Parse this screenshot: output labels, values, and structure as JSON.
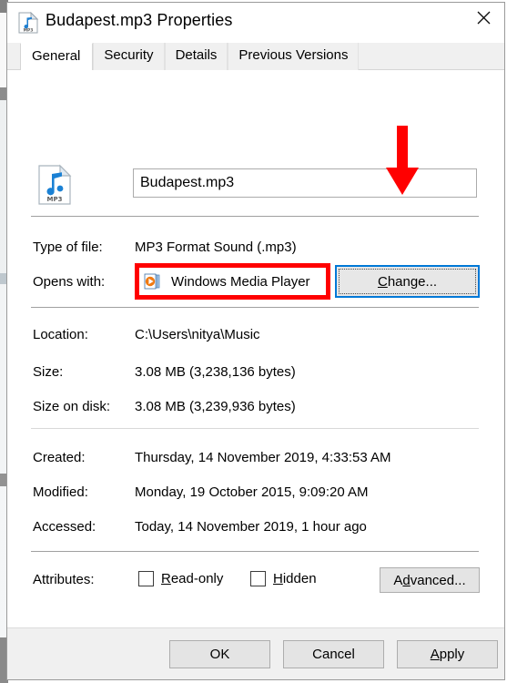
{
  "window": {
    "title": "Budapest.mp3 Properties",
    "icon": "mp3-file-icon",
    "close_icon": "close-icon"
  },
  "tabs": [
    {
      "label": "General",
      "active": true
    },
    {
      "label": "Security",
      "active": false
    },
    {
      "label": "Details",
      "active": false
    },
    {
      "label": "Previous Versions",
      "active": false
    }
  ],
  "general": {
    "filename": "Budapest.mp3",
    "type_of_file": {
      "label": "Type of file:",
      "value": "MP3 Format Sound (.mp3)"
    },
    "opens_with": {
      "label": "Opens with:",
      "app_name": "Windows Media Player",
      "app_icon": "windows-media-player-icon",
      "change_button": {
        "mnemonic": "C",
        "rest": "hange..."
      }
    },
    "location": {
      "label": "Location:",
      "value": "C:\\Users\\nitya\\Music"
    },
    "size": {
      "label": "Size:",
      "value": "3.08 MB (3,238,136 bytes)"
    },
    "size_on_disk": {
      "label": "Size on disk:",
      "value": "3.08 MB (3,239,936 bytes)"
    },
    "created": {
      "label": "Created:",
      "value": "Thursday, 14 November 2019, 4:33:53 AM"
    },
    "modified": {
      "label": "Modified:",
      "value": "Monday, 19 October 2015, 9:09:20 AM"
    },
    "accessed": {
      "label": "Accessed:",
      "value": "Today, 14 November 2019, 1 hour ago"
    },
    "attributes": {
      "label": "Attributes:",
      "readonly": {
        "mnemonic": "R",
        "rest": "ead-only",
        "checked": false
      },
      "hidden": {
        "mnemonic": "H",
        "rest": "idden",
        "checked": false
      },
      "advanced_button": {
        "pre": "A",
        "mnemonic": "d",
        "rest": "vanced..."
      }
    }
  },
  "footer": {
    "ok": "OK",
    "cancel": "Cancel",
    "apply": {
      "mnemonic": "A",
      "rest": "pply"
    }
  },
  "annotations": {
    "highlight_box_target": "Windows Media Player",
    "arrow_target": "Change...",
    "color": "#ff0000"
  }
}
